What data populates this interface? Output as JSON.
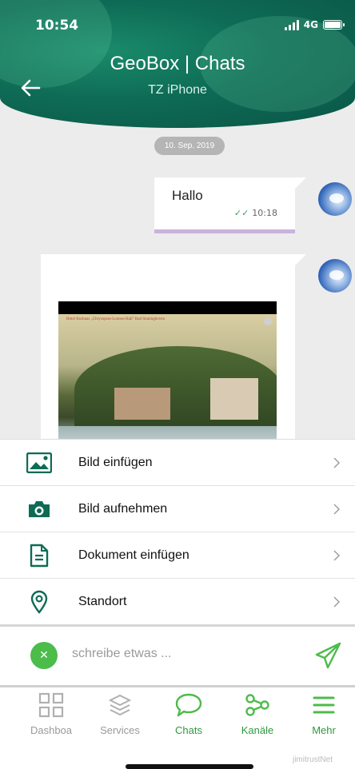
{
  "status_bar": {
    "time": "10:54",
    "network": "4G"
  },
  "header": {
    "title": "GeoBox | Chats",
    "subtitle": "TZ iPhone"
  },
  "chat": {
    "date_divider": "10. Sep. 2019",
    "messages": [
      {
        "text": "Hallo",
        "time": "10:18",
        "ticks": "✓✓"
      }
    ],
    "photo_caption": "Hotel Kurhaus „Chrysopras-Louises Hall\" Bad Sinninghoven"
  },
  "action_sheet": {
    "items": [
      {
        "label": "Bild einfügen",
        "icon": "image-icon"
      },
      {
        "label": "Bild aufnehmen",
        "icon": "camera-icon"
      },
      {
        "label": "Dokument einfügen",
        "icon": "document-icon"
      },
      {
        "label": "Standort",
        "icon": "location-pin-icon"
      }
    ]
  },
  "composer": {
    "placeholder": "schreibe etwas ..."
  },
  "tabbar": {
    "tabs": [
      {
        "label": "Dashboa",
        "icon": "dashboard-icon",
        "active": false
      },
      {
        "label": "Services",
        "icon": "services-icon",
        "active": false
      },
      {
        "label": "Chats",
        "icon": "chat-icon",
        "active": true
      },
      {
        "label": "Kanäle",
        "icon": "share-icon",
        "active": false
      },
      {
        "label": "Mehr",
        "icon": "menu-icon",
        "active": false
      }
    ]
  },
  "watermark": "jimitrustNet",
  "colors": {
    "accent": "#4cbc4a",
    "header": "#0e6b55",
    "inactive": "#aaaaaa"
  }
}
